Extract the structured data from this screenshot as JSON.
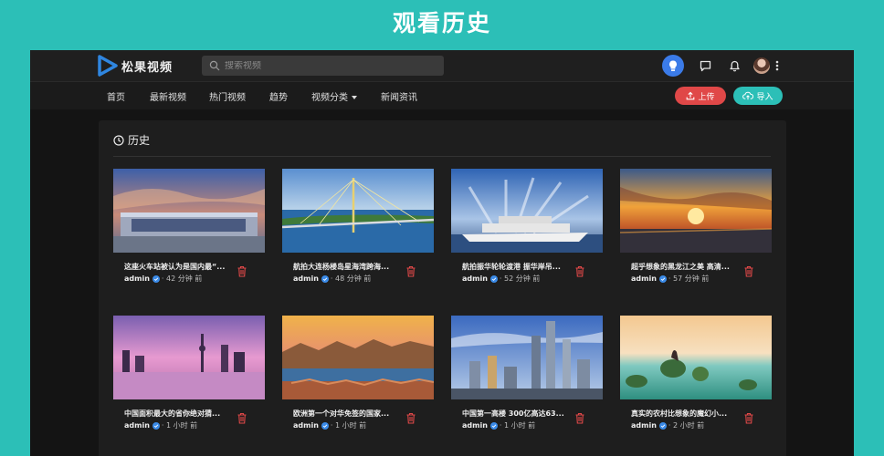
{
  "banner": {
    "title": "观看历史"
  },
  "header": {
    "logo_text": "松果视频",
    "search_placeholder": "搜索视频"
  },
  "nav": {
    "items": [
      "首页",
      "最新视频",
      "热门视频",
      "趋势",
      "视频分类",
      "新闻资讯"
    ],
    "upload_label": "上传",
    "import_label": "导入"
  },
  "history": {
    "title": "历史",
    "videos": [
      {
        "title": "这座火车站被认为是国内最“...",
        "author": "admin",
        "time": "· 42 分钟 前"
      },
      {
        "title": "航拍大连杨楼岛星海湾跨海...",
        "author": "admin",
        "time": "· 48 分钟 前"
      },
      {
        "title": "航拍振华轮轮渡港 振华岸吊...",
        "author": "admin",
        "time": "· 52 分钟 前"
      },
      {
        "title": "超乎想象的黑龙江之美 高清...",
        "author": "admin",
        "time": "· 57 分钟 前"
      },
      {
        "title": "中国面积最大的省你绝对猜...",
        "author": "admin",
        "time": "· 1 小时 前"
      },
      {
        "title": "欧洲第一个对华免签的国家...",
        "author": "admin",
        "time": "· 1 小时 前"
      },
      {
        "title": "中国第一高楼 300亿高达63...",
        "author": "admin",
        "time": "· 1 小时 前"
      },
      {
        "title": "真实的农村比想象的魔幻小...",
        "author": "admin",
        "time": "· 2 小时 前"
      }
    ]
  },
  "colors": {
    "accent": "#2cbfb7",
    "danger": "#e04848",
    "bulb": "#3b7be8"
  }
}
